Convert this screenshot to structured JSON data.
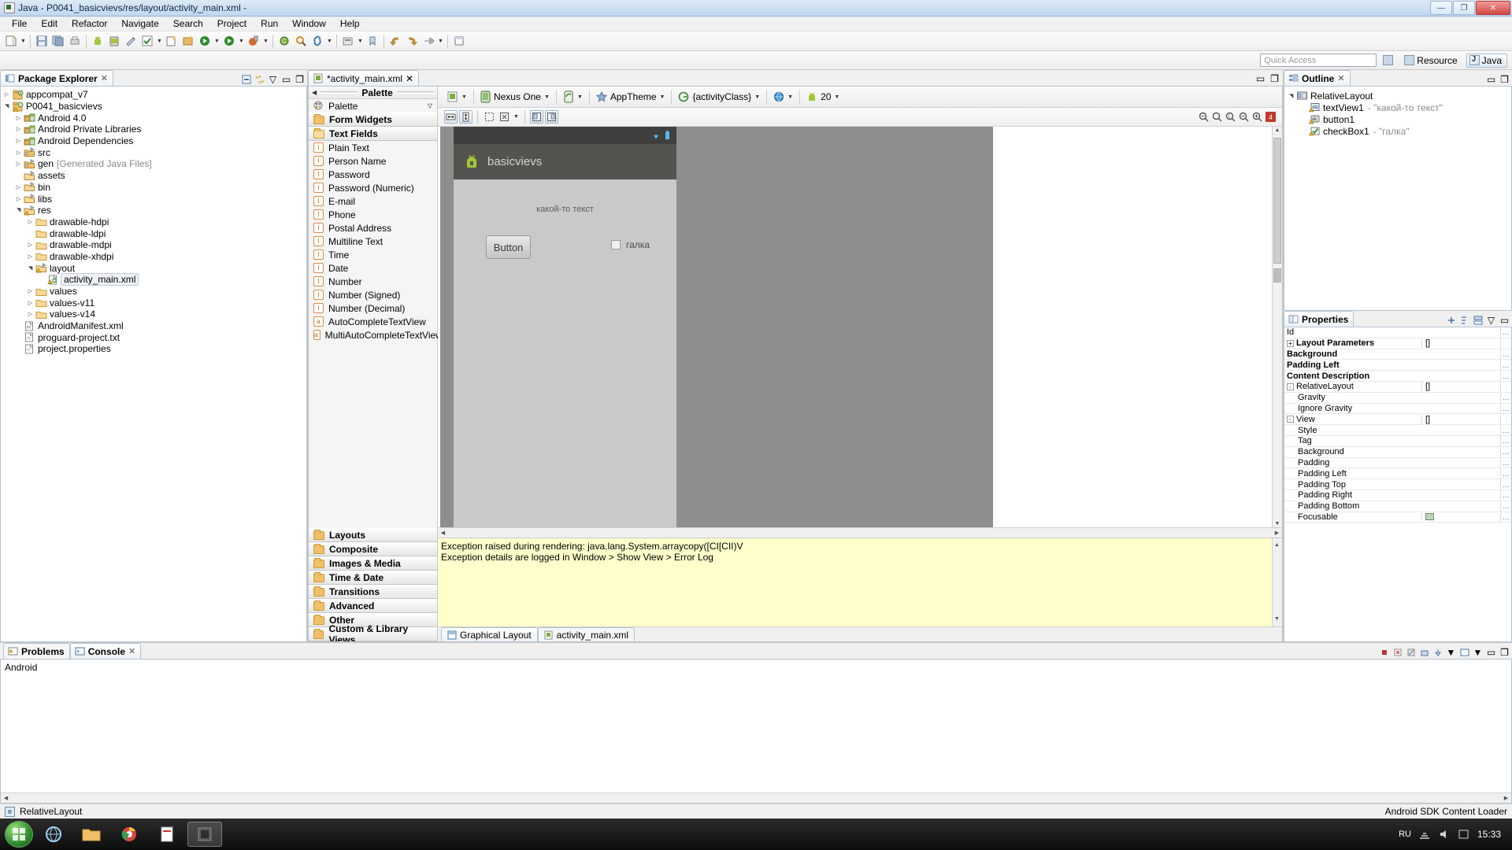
{
  "window": {
    "title": "Java - P0041_basicvievs/res/layout/activity_main.xml -",
    "minimize": "—",
    "maximize": "❐",
    "close": "✕"
  },
  "menu": [
    "File",
    "Edit",
    "Refactor",
    "Navigate",
    "Search",
    "Project",
    "Run",
    "Window",
    "Help"
  ],
  "perspective": {
    "quick_access_placeholder": "Quick Access",
    "resource_label": "Resource",
    "java_label": "Java"
  },
  "package_explorer": {
    "tab_label": "Package Explorer",
    "items": [
      {
        "label": "appcompat_v7",
        "depth": 0,
        "arrow": "collapsed",
        "icon": "java-project-icon",
        "suffix": ""
      },
      {
        "label": "P0041_basicvievs",
        "depth": 0,
        "arrow": "expanded",
        "icon": "java-project-warning-icon",
        "suffix": ""
      },
      {
        "label": "Android 4.0",
        "depth": 1,
        "arrow": "collapsed",
        "icon": "library-icon",
        "suffix": ""
      },
      {
        "label": "Android Private Libraries",
        "depth": 1,
        "arrow": "collapsed",
        "icon": "library-icon",
        "suffix": ""
      },
      {
        "label": "Android Dependencies",
        "depth": 1,
        "arrow": "collapsed",
        "icon": "library-icon",
        "suffix": ""
      },
      {
        "label": "src",
        "depth": 1,
        "arrow": "collapsed",
        "icon": "source-folder-icon",
        "suffix": ""
      },
      {
        "label": "gen",
        "depth": 1,
        "arrow": "collapsed",
        "icon": "source-folder-icon",
        "suffix": "[Generated Java Files]"
      },
      {
        "label": "assets",
        "depth": 1,
        "arrow": "none",
        "icon": "folder-icon",
        "suffix": ""
      },
      {
        "label": "bin",
        "depth": 1,
        "arrow": "collapsed",
        "icon": "folder-icon",
        "suffix": ""
      },
      {
        "label": "libs",
        "depth": 1,
        "arrow": "collapsed",
        "icon": "folder-icon",
        "suffix": ""
      },
      {
        "label": "res",
        "depth": 1,
        "arrow": "expanded",
        "icon": "folder-warning-icon",
        "suffix": ""
      },
      {
        "label": "drawable-hdpi",
        "depth": 2,
        "arrow": "collapsed",
        "icon": "folder-plain-icon",
        "suffix": ""
      },
      {
        "label": "drawable-ldpi",
        "depth": 2,
        "arrow": "none",
        "icon": "folder-plain-icon",
        "suffix": ""
      },
      {
        "label": "drawable-mdpi",
        "depth": 2,
        "arrow": "collapsed",
        "icon": "folder-plain-icon",
        "suffix": ""
      },
      {
        "label": "drawable-xhdpi",
        "depth": 2,
        "arrow": "collapsed",
        "icon": "folder-plain-icon",
        "suffix": ""
      },
      {
        "label": "layout",
        "depth": 2,
        "arrow": "expanded",
        "icon": "folder-warning-icon",
        "suffix": ""
      },
      {
        "label": "activity_main.xml",
        "depth": 3,
        "arrow": "none",
        "icon": "xml-warning-icon",
        "suffix": "",
        "selected": true
      },
      {
        "label": "values",
        "depth": 2,
        "arrow": "collapsed",
        "icon": "folder-plain-icon",
        "suffix": ""
      },
      {
        "label": "values-v11",
        "depth": 2,
        "arrow": "collapsed",
        "icon": "folder-plain-icon",
        "suffix": ""
      },
      {
        "label": "values-v14",
        "depth": 2,
        "arrow": "collapsed",
        "icon": "folder-plain-icon",
        "suffix": ""
      },
      {
        "label": "AndroidManifest.xml",
        "depth": 1,
        "arrow": "none",
        "icon": "manifest-icon",
        "suffix": ""
      },
      {
        "label": "proguard-project.txt",
        "depth": 1,
        "arrow": "none",
        "icon": "text-file-icon",
        "suffix": ""
      },
      {
        "label": "project.properties",
        "depth": 1,
        "arrow": "none",
        "icon": "properties-file-icon",
        "suffix": ""
      }
    ]
  },
  "editor": {
    "tab_label": "*activity_main.xml",
    "palette": {
      "header_title": "Palette",
      "root_label": "Palette",
      "groups_top": [
        {
          "label": "Form Widgets",
          "open": false
        },
        {
          "label": "Text Fields",
          "open": true
        }
      ],
      "text_fields": [
        "Plain Text",
        "Person Name",
        "Password",
        "Password (Numeric)",
        "E-mail",
        "Phone",
        "Postal Address",
        "Multiline Text",
        "Time",
        "Date",
        "Number",
        "Number (Signed)",
        "Number (Decimal)",
        "AutoCompleteTextView",
        "MultiAutoCompleteTextView"
      ],
      "field_icons": [
        "I",
        "I",
        "I",
        "I",
        "I",
        "I",
        "I",
        "I",
        "I",
        "I",
        "I",
        "I",
        "I",
        "a",
        "a:"
      ],
      "groups_bottom": [
        "Layouts",
        "Composite",
        "Images & Media",
        "Time & Date",
        "Transitions",
        "Advanced",
        "Other",
        "Custom & Library Views"
      ]
    },
    "config_bar": {
      "device": "Nexus One",
      "theme": "AppTheme",
      "activity": "{activityClass}",
      "api_level": "20"
    },
    "zoom_error_count": "4",
    "preview": {
      "app_name": "basicvievs",
      "text_view": "какой-то текст",
      "button": "Button",
      "checkbox": "галка"
    },
    "error_log": {
      "line1": "Exception raised during rendering: java.lang.System.arraycopy([CI[CII)V",
      "line2": "Exception details are logged in Window > Show View > Error Log"
    },
    "bottom_tabs": [
      {
        "label": "Graphical Layout",
        "selected": true
      },
      {
        "label": "activity_main.xml",
        "selected": false
      }
    ]
  },
  "outline": {
    "tab_label": "Outline",
    "items": [
      {
        "label": "RelativeLayout",
        "value": "",
        "depth": 0,
        "arrow": "expanded",
        "icon": "relative-layout-icon"
      },
      {
        "label": "textView1",
        "value": "- \"какой-то текст\"",
        "depth": 1,
        "arrow": "none",
        "icon": "textview-warning-icon"
      },
      {
        "label": "button1",
        "value": "",
        "depth": 1,
        "arrow": "none",
        "icon": "button-warning-icon"
      },
      {
        "label": "checkBox1",
        "value": "- \"галка\"",
        "depth": 1,
        "arrow": "none",
        "icon": "checkbox-warning-icon"
      }
    ]
  },
  "properties": {
    "tab_label": "Properties",
    "rows": [
      {
        "name": "Id",
        "value": "",
        "bold": false,
        "indent": 0,
        "expander": "",
        "button": true
      },
      {
        "name": "Layout Parameters",
        "value": "[]",
        "bold": true,
        "indent": 0,
        "expander": "+",
        "button": false
      },
      {
        "name": "Background",
        "value": "",
        "bold": true,
        "indent": 0,
        "expander": "",
        "button": true
      },
      {
        "name": "Padding Left",
        "value": "",
        "bold": true,
        "indent": 0,
        "expander": "",
        "button": true
      },
      {
        "name": "Content Description",
        "value": "",
        "bold": true,
        "indent": 0,
        "expander": "",
        "button": true
      },
      {
        "name": "RelativeLayout",
        "value": "[]",
        "bold": false,
        "indent": 0,
        "expander": "-",
        "button": false
      },
      {
        "name": "Gravity",
        "value": "",
        "bold": false,
        "indent": 1,
        "expander": "",
        "button": true
      },
      {
        "name": "Ignore Gravity",
        "value": "",
        "bold": false,
        "indent": 1,
        "expander": "",
        "button": true
      },
      {
        "name": "View",
        "value": "[]",
        "bold": false,
        "indent": 0,
        "expander": "-",
        "button": false
      },
      {
        "name": "Style",
        "value": "",
        "bold": false,
        "indent": 1,
        "expander": "",
        "button": true
      },
      {
        "name": "Tag",
        "value": "",
        "bold": false,
        "indent": 1,
        "expander": "",
        "button": true
      },
      {
        "name": "Background",
        "value": "",
        "bold": false,
        "indent": 1,
        "expander": "",
        "button": true
      },
      {
        "name": "Padding",
        "value": "",
        "bold": false,
        "indent": 1,
        "expander": "",
        "button": true
      },
      {
        "name": "Padding Left",
        "value": "",
        "bold": false,
        "indent": 1,
        "expander": "",
        "button": true
      },
      {
        "name": "Padding Top",
        "value": "",
        "bold": false,
        "indent": 1,
        "expander": "",
        "button": true
      },
      {
        "name": "Padding Right",
        "value": "",
        "bold": false,
        "indent": 1,
        "expander": "",
        "button": true
      },
      {
        "name": "Padding Bottom",
        "value": "",
        "bold": false,
        "indent": 1,
        "expander": "",
        "button": true
      },
      {
        "name": "Focusable",
        "value": "swatch",
        "bold": false,
        "indent": 1,
        "expander": "",
        "button": true
      }
    ]
  },
  "bottom_panel": {
    "tabs": [
      {
        "label": "Problems",
        "selected": false,
        "icon": "problems-icon"
      },
      {
        "label": "Console",
        "selected": true,
        "icon": "console-icon"
      }
    ],
    "console_text": "Android"
  },
  "status_bar": {
    "left_text": "RelativeLayout",
    "right_text": "Android SDK Content Loader"
  },
  "taskbar": {
    "language": "RU",
    "clock": "15:33"
  },
  "colors": {
    "accent": "#3f7fbf",
    "error_bg": "#ffffcc",
    "error_badge": "#c0392b",
    "android_green": "#a4c639",
    "device_bg": "#c9c9c9",
    "actionbar": "#55534f"
  }
}
